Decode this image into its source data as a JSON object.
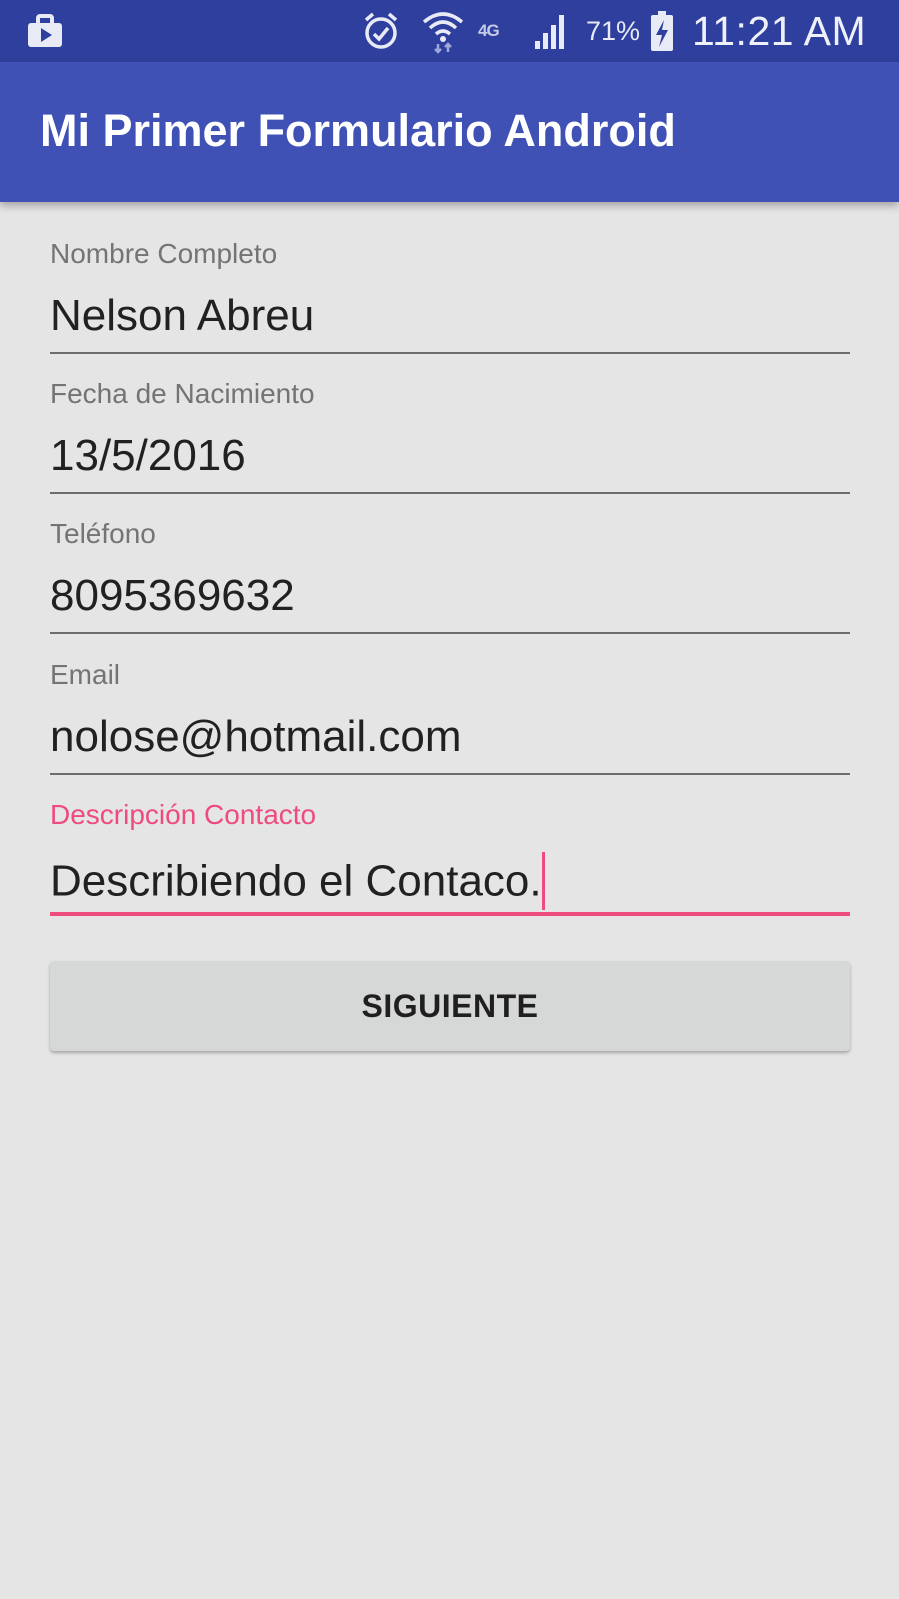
{
  "status_bar": {
    "left_icon": "work-profile-icon",
    "alarm_icon": "alarm-clock-icon",
    "wifi_icon": "wifi-icon",
    "network_type": "4G",
    "signal_icon": "signal-bars-icon",
    "battery_percent": "71%",
    "battery_icon": "battery-charging-icon",
    "time": "11:21 AM"
  },
  "app_bar": {
    "title": "Mi Primer Formulario Android"
  },
  "form": {
    "fields": [
      {
        "label": "Nombre Completo",
        "value": "Nelson Abreu"
      },
      {
        "label": "Fecha de Nacimiento",
        "value": "13/5/2016"
      },
      {
        "label": "Teléfono",
        "value": "8095369632"
      },
      {
        "label": "Email",
        "value": "nolose@hotmail.com"
      },
      {
        "label": "Descripción Contacto",
        "value": "Describiendo el Contaco."
      }
    ],
    "submit_label": "SIGUIENTE"
  },
  "colors": {
    "status_bar": "#2f3f9e",
    "app_bar": "#3f51b5",
    "accent": "#ee4b7f",
    "background": "#e5e5e5",
    "button": "#d6d7d7"
  }
}
